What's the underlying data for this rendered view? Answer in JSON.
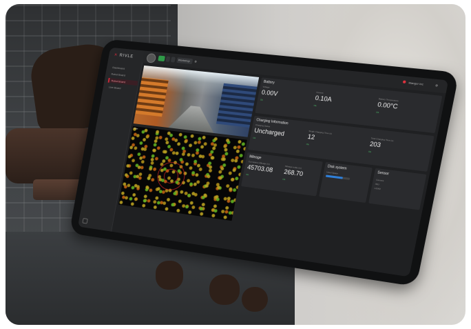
{
  "photo": {
    "description_icons": [
      "hand-left",
      "hands-holding-tablet"
    ]
  },
  "app": {
    "logo_text": "RIVLE",
    "sidebar_items": [
      "Dashboard",
      "Robot Board",
      "Robot Board",
      "Live Board"
    ],
    "topbar": {
      "status_label": "",
      "mode_label": "Workshop",
      "user_label": "Mangor Inc"
    }
  },
  "camera": {
    "label": "Camera"
  },
  "lidar": {
    "label": "Lidar"
  },
  "battery": {
    "title": "Battery",
    "voltage_label": "Voltage",
    "voltage_value": "0.00V",
    "current_label": "Current",
    "current_value": "0.10A",
    "temp_label": "Battery Temperature",
    "temp_value": "0.00°C",
    "ok_label": "Ok"
  },
  "charging": {
    "title": "Charging Information",
    "status_label": "Charging Status",
    "status_value": "Uncharged",
    "single_label": "Single Charging Time (s)",
    "single_value": "12",
    "total_label": "Total Charging Time (s)",
    "total_value": "203",
    "ok_label": "Ok"
  },
  "mileage": {
    "title": "Mileage",
    "cumulative_label": "Cumulative Mileage (m)",
    "cumulative_value": "45703.08",
    "today_label": "Mileage today (m)",
    "today_value": "268.70",
    "ok_label": "Ok"
  },
  "disk": {
    "title": "Disk system",
    "used_label": "Used Space",
    "fill_fraction": 0.7
  },
  "sensor": {
    "title": "Sensor",
    "rows": [
      "Camera",
      "IMU",
      "LiDAR"
    ]
  },
  "colors": {
    "accent": "#d12a3a",
    "ok": "#4ec46b",
    "disk": "#2f7fd8"
  }
}
